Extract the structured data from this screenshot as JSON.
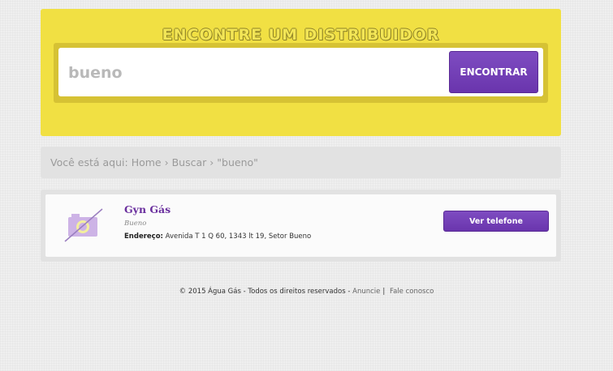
{
  "search": {
    "title": "ENCONTRE UM DISTRIBUIDOR",
    "query": "bueno",
    "button_label": "ENCONTRAR"
  },
  "breadcrumb": {
    "prefix": "Você está aqui:",
    "items": [
      "Home",
      "Buscar",
      "\"bueno\""
    ],
    "separator": "›"
  },
  "results": [
    {
      "name": "Gyn Gás",
      "district": "Bueno",
      "address_label": "Endereço:",
      "address": "Avenida T 1 Q 60, 1343 lt 19, Setor Bueno",
      "button_label": "Ver telefone",
      "thumb_icon": "no-image-camera-icon"
    }
  ],
  "footer": {
    "copyright": "© 2015 Água Gás - Todos os direitos reservados -",
    "link_advertise": "Anuncie",
    "separator": "|",
    "link_contact": "Fale conosco"
  },
  "colors": {
    "panel_yellow": "#f1e043",
    "accent_purple": "#6a35ad",
    "name_purple": "#6a2f9e"
  }
}
